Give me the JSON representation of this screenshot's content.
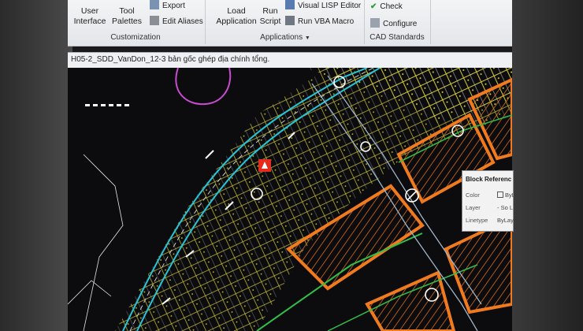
{
  "ribbon": {
    "user_interface": "User\nInterface",
    "tool_palettes": "Tool\nPalettes",
    "export": "Export",
    "edit_aliases": "Edit Aliases",
    "load_application": "Load\nApplication",
    "run_script": "Run\nScript",
    "visual_lisp_editor": "Visual LISP Editor",
    "run_vba_macro": "Run VBA Macro",
    "check": "Check",
    "configure": "Configure",
    "group_customization": "Customization",
    "group_applications": "Applications",
    "group_cad_standards": "CAD Standards"
  },
  "document": {
    "title": "H05-2_SDD_VanDon_12-3 bản gốc ghép địa chính tổng."
  },
  "properties_popup": {
    "title": "Block Referenc",
    "color_label": "Color",
    "color_value": "ByL",
    "layer_label": "Layer",
    "layer_value": "- So L",
    "linetype_label": "Linetype",
    "linetype_value": "ByLay"
  },
  "colors": {
    "ribbon_bg": "#e9ecef",
    "drawing_bg": "#0c0c0e",
    "road_cyan": "#27c4d8",
    "parcel_yellow": "#d8d03a",
    "zone_orange": "#f07a1e",
    "contour_magenta": "#c84bd0",
    "selection_red": "#e32b1e",
    "check_green": "#2e9c3c"
  },
  "icons": [
    "export-icon",
    "edit-aliases-icon",
    "visual-lisp-icon",
    "run-vba-icon",
    "check-icon",
    "configure-icon",
    "dropdown-arrow-icon"
  ]
}
